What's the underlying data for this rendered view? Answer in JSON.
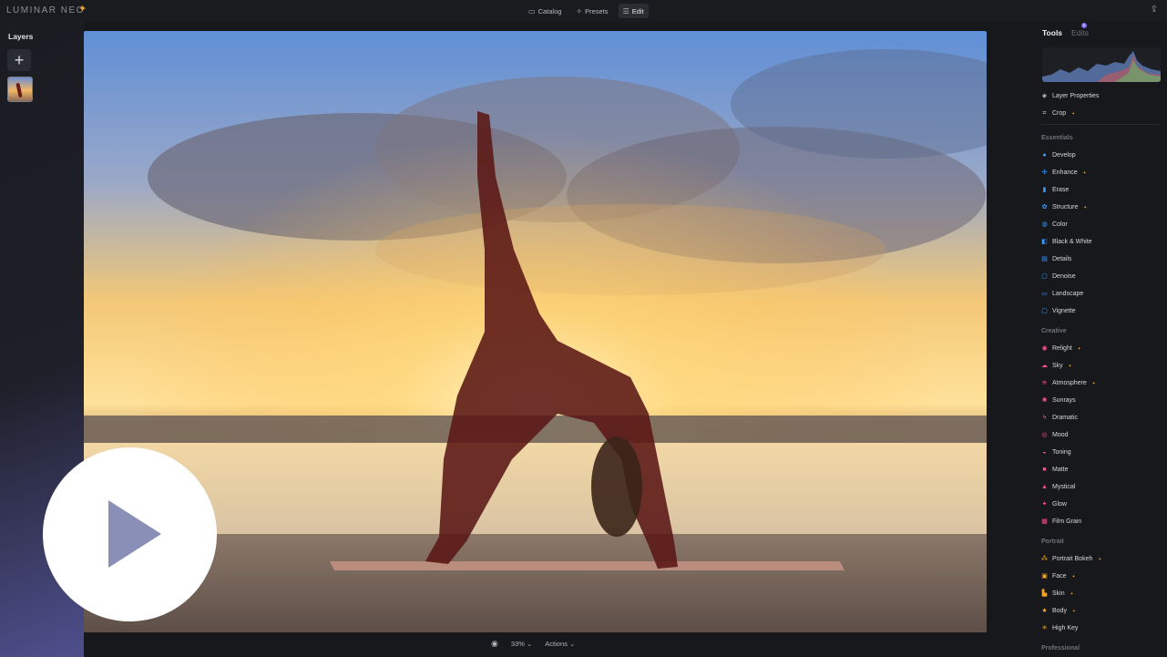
{
  "app": {
    "logo_text": "LUMINAR NEO"
  },
  "topnav": [
    {
      "label": "Catalog",
      "icon": "folder-icon",
      "active": false
    },
    {
      "label": "Presets",
      "icon": "presets-icon",
      "active": false
    },
    {
      "label": "Edit",
      "icon": "sliders-icon",
      "active": true
    }
  ],
  "layers": {
    "title": "Layers"
  },
  "bottom": {
    "zoom": "33%",
    "actions": "Actions"
  },
  "right": {
    "tabs": [
      {
        "label": "Tools",
        "active": true
      },
      {
        "label": "Edits",
        "active": false
      }
    ],
    "edits_count": "2",
    "top_tools": [
      {
        "label": "Layer Properties",
        "icon": "layers-icon",
        "ai": false,
        "color": "#c9cbd1"
      },
      {
        "label": "Crop",
        "icon": "crop-icon",
        "ai": true,
        "color": "#c9cbd1"
      }
    ],
    "sections": [
      {
        "title": "Essentials",
        "tools": [
          {
            "label": "Develop",
            "icon": "develop-icon",
            "ai": false,
            "color": "#3aa0ff"
          },
          {
            "label": "Enhance",
            "icon": "enhance-icon",
            "ai": true,
            "color": "#3aa0ff"
          },
          {
            "label": "Erase",
            "icon": "erase-icon",
            "ai": false,
            "color": "#3aa0ff"
          },
          {
            "label": "Structure",
            "icon": "structure-icon",
            "ai": true,
            "color": "#3aa0ff"
          },
          {
            "label": "Color",
            "icon": "color-icon",
            "ai": false,
            "color": "#3aa0ff"
          },
          {
            "label": "Black & White",
            "icon": "bw-icon",
            "ai": false,
            "color": "#3aa0ff"
          },
          {
            "label": "Details",
            "icon": "details-icon",
            "ai": false,
            "color": "#3aa0ff"
          },
          {
            "label": "Denoise",
            "icon": "denoise-icon",
            "ai": false,
            "color": "#3aa0ff"
          },
          {
            "label": "Landscape",
            "icon": "landscape-icon",
            "ai": false,
            "color": "#3aa0ff"
          },
          {
            "label": "Vignette",
            "icon": "vignette-icon",
            "ai": false,
            "color": "#3aa0ff"
          }
        ]
      },
      {
        "title": "Creative",
        "tools": [
          {
            "label": "Relight",
            "icon": "relight-icon",
            "ai": true,
            "color": "#ff4f8a"
          },
          {
            "label": "Sky",
            "icon": "sky-icon",
            "ai": true,
            "color": "#ff4f8a"
          },
          {
            "label": "Atmosphere",
            "icon": "atmosphere-icon",
            "ai": true,
            "color": "#ff4f8a"
          },
          {
            "label": "Sunrays",
            "icon": "sunrays-icon",
            "ai": false,
            "color": "#ff4f8a"
          },
          {
            "label": "Dramatic",
            "icon": "dramatic-icon",
            "ai": false,
            "color": "#ff4f8a"
          },
          {
            "label": "Mood",
            "icon": "mood-icon",
            "ai": false,
            "color": "#ff4f8a"
          },
          {
            "label": "Toning",
            "icon": "toning-icon",
            "ai": false,
            "color": "#ff4f8a"
          },
          {
            "label": "Matte",
            "icon": "matte-icon",
            "ai": false,
            "color": "#ff4f8a"
          },
          {
            "label": "Mystical",
            "icon": "mystical-icon",
            "ai": false,
            "color": "#ff4f8a"
          },
          {
            "label": "Glow",
            "icon": "glow-icon",
            "ai": false,
            "color": "#ff4f8a"
          },
          {
            "label": "Film Grain",
            "icon": "film-grain-icon",
            "ai": false,
            "color": "#ff4f8a"
          }
        ]
      },
      {
        "title": "Portrait",
        "tools": [
          {
            "label": "Portrait Bokeh",
            "icon": "bokeh-icon",
            "ai": true,
            "color": "#f5a623"
          },
          {
            "label": "Face",
            "icon": "face-icon",
            "ai": true,
            "color": "#f5a623"
          },
          {
            "label": "Skin",
            "icon": "skin-icon",
            "ai": true,
            "color": "#f5a623"
          },
          {
            "label": "Body",
            "icon": "body-icon",
            "ai": true,
            "color": "#f5a623"
          },
          {
            "label": "High Key",
            "icon": "highkey-icon",
            "ai": false,
            "color": "#f5a623"
          }
        ]
      },
      {
        "title": "Professional",
        "tools": []
      }
    ]
  },
  "colors": {
    "accent": "#7a6cff",
    "essentials": "#3aa0ff",
    "creative": "#ff4f8a",
    "portrait": "#f5a623",
    "ai_badge": "#e9a23b"
  }
}
